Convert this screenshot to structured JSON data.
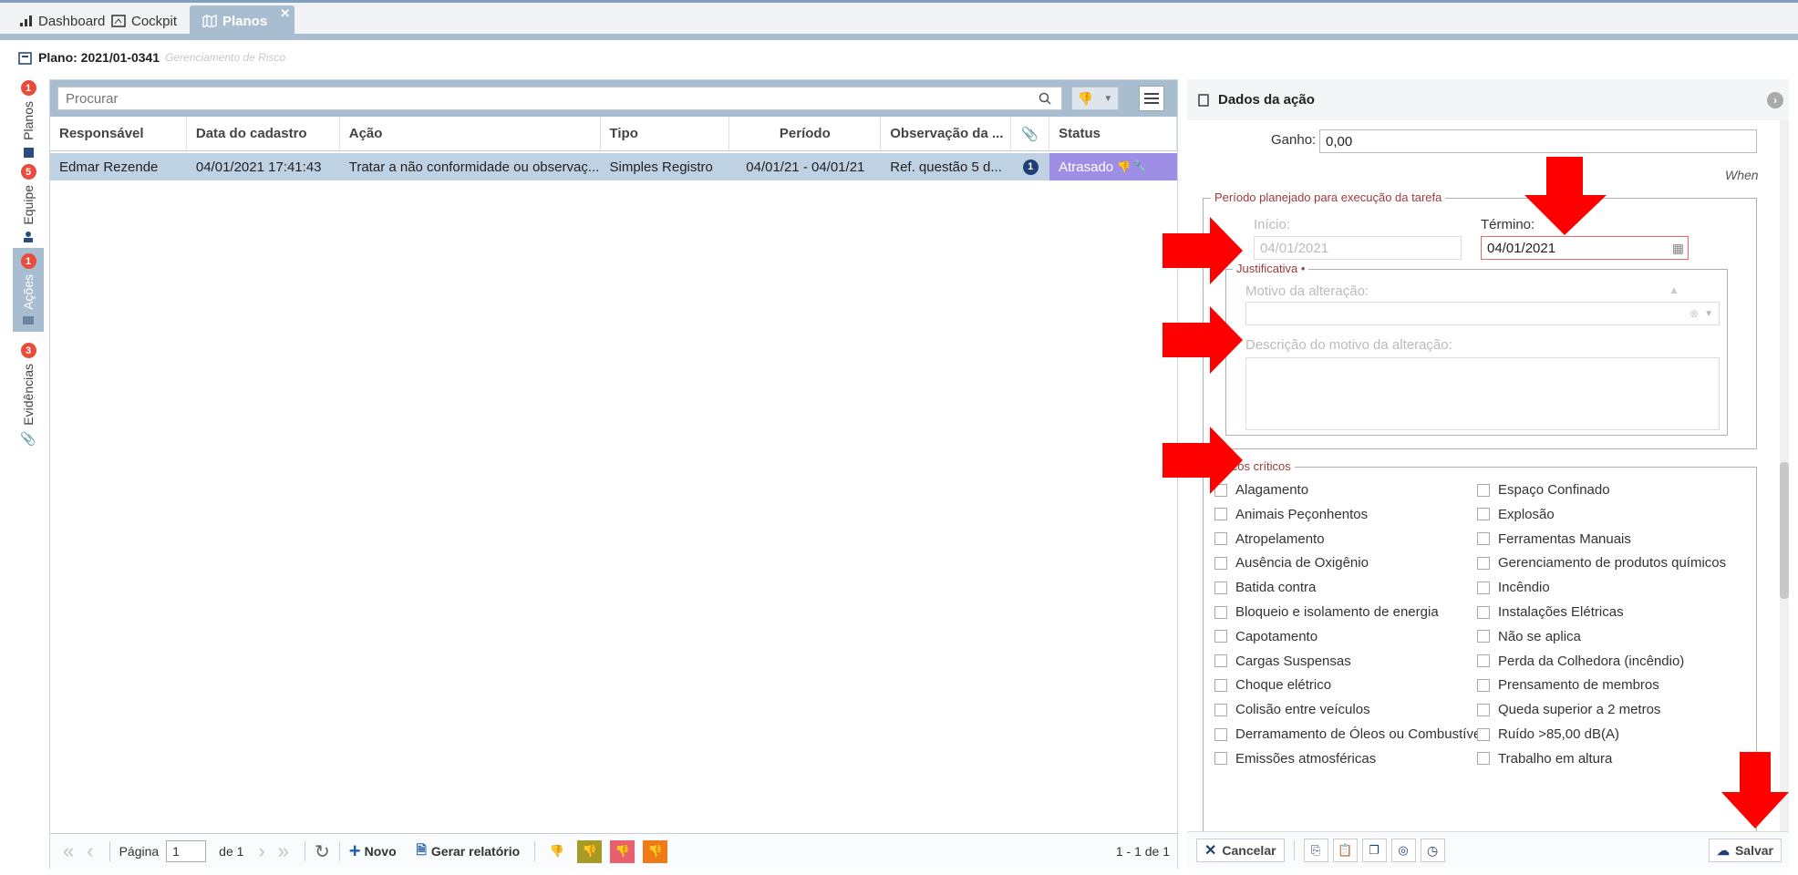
{
  "tabs": [
    {
      "label": "Dashboard"
    },
    {
      "label": "Cockpit"
    },
    {
      "label": "Planos"
    }
  ],
  "plan": {
    "title": "Plano: 2021/01-0341",
    "subtitle": "Gerenciamento de Risco"
  },
  "side_tabs": [
    {
      "label": "Planos",
      "badge": "1"
    },
    {
      "label": "Equipe",
      "badge": "5"
    },
    {
      "label": "Ações",
      "badge": "1"
    },
    {
      "label": "Evidências",
      "badge": "3"
    }
  ],
  "search": {
    "placeholder": "Procurar"
  },
  "columns": [
    "Responsável",
    "Data do cadastro",
    "Ação",
    "Tipo",
    "Período",
    "Observação da ...",
    "Status"
  ],
  "row": {
    "responsavel": "Edmar Rezende",
    "data": "04/01/2021 17:41:43",
    "acao": "Tratar a não conformidade ou observaç...",
    "tipo": "Simples Registro",
    "periodo": "04/01/21 - 04/01/21",
    "obs": "Ref. questão 5 d...",
    "anexos": "1",
    "status": "Atrasado"
  },
  "pager": {
    "label": "Página",
    "page": "1",
    "of": "de 1",
    "novo": "Novo",
    "report": "Gerar relatório",
    "range": "1 - 1 de 1"
  },
  "panel": {
    "title": "Dados da ação",
    "ganho_label": "Ganho:",
    "ganho_value": "0,00",
    "when": "When",
    "periodo_legend": "Período planejado para execução da tarefa",
    "inicio_label": "Início:",
    "inicio_value": "04/01/2021",
    "termino_label": "Término:",
    "termino_value": "04/01/2021",
    "just_legend": "Justificativa",
    "motivo_label": "Motivo da alteração:",
    "descricao_label": "Descrição do motivo da alteração:",
    "riscos_legend": "Riscos críticos",
    "riscos_left": [
      "Alagamento",
      "Animais Peçonhentos",
      "Atropelamento",
      "Ausência de Oxigênio",
      "Batida contra",
      "Bloqueio e isolamento de energia",
      "Capotamento",
      "Cargas Suspensas",
      "Choque elétrico",
      "Colisão entre veículos",
      "Derramamento de Óleos ou Combustível",
      "Emissões atmosféricas"
    ],
    "riscos_right": [
      "Espaço Confinado",
      "Explosão",
      "Ferramentas Manuais",
      "Gerenciamento de produtos químicos",
      "Incêndio",
      "Instalações Elétricas",
      "Não se aplica",
      "Perda da Colhedora (incêndio)",
      "Prensamento de membros",
      "Queda superior a 2 metros",
      "Ruído >85,00 dB(A)",
      "Trabalho em altura"
    ],
    "cancel": "Cancelar",
    "save": "Salvar"
  },
  "colors": {
    "accent": "#a9bdd1",
    "status": "#9f8ee6",
    "arrow": "#ff0000"
  }
}
